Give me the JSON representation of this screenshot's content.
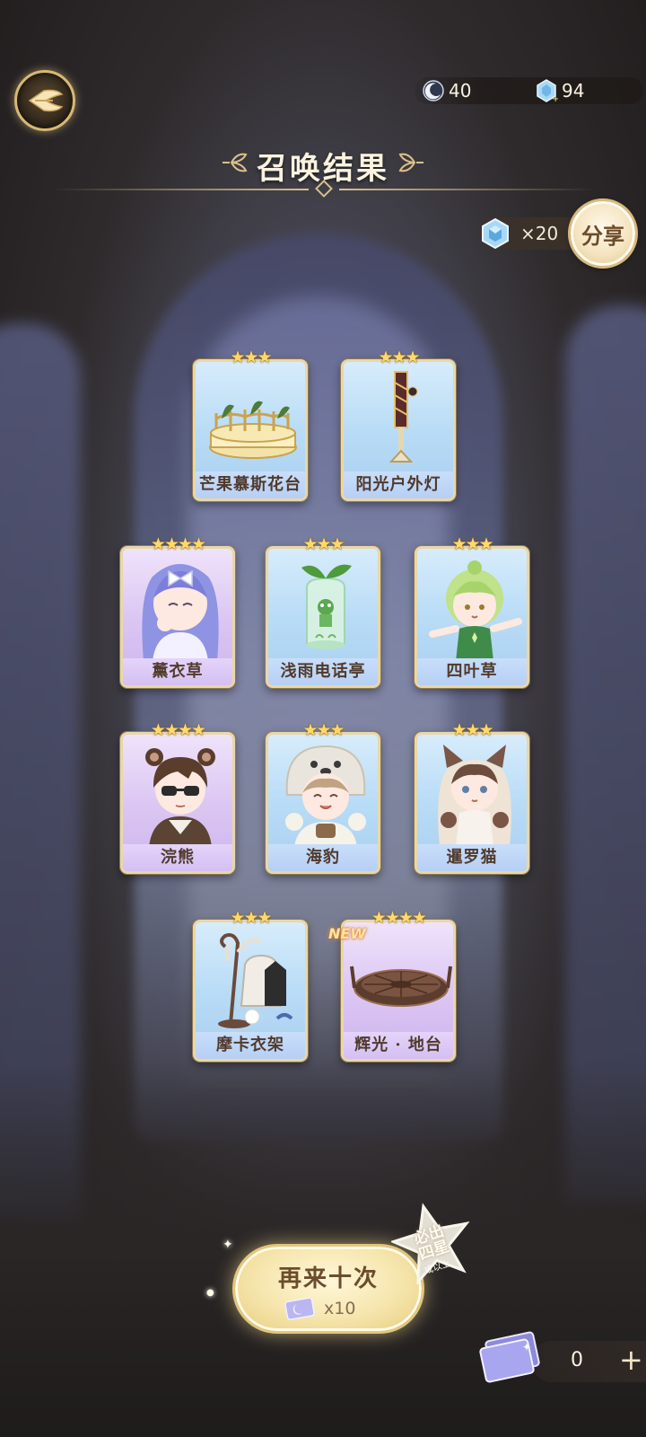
{
  "topbar": {
    "moon_count": "40",
    "gem_count": "94"
  },
  "page_title": "召唤结果",
  "share": {
    "reward_count": "×20",
    "label": "分享"
  },
  "cards": [
    {
      "name": "芒果慕斯花台",
      "stars": "★★★",
      "bg": "blue",
      "is_new": false
    },
    {
      "name": "阳光户外灯",
      "stars": "★★★",
      "bg": "blue",
      "is_new": false
    },
    {
      "name": "薰衣草",
      "stars": "★★★★",
      "bg": "purple",
      "is_new": false
    },
    {
      "name": "浅雨电话亭",
      "stars": "★★★",
      "bg": "blue",
      "is_new": false
    },
    {
      "name": "四叶草",
      "stars": "★★★",
      "bg": "blue",
      "is_new": false
    },
    {
      "name": "浣熊",
      "stars": "★★★★",
      "bg": "purple",
      "is_new": false
    },
    {
      "name": "海豹",
      "stars": "★★★",
      "bg": "blue",
      "is_new": false
    },
    {
      "name": "暹罗猫",
      "stars": "★★★",
      "bg": "blue",
      "is_new": false
    },
    {
      "name": "摩卡衣架",
      "stars": "★★★",
      "bg": "blue",
      "is_new": false
    },
    {
      "name": "辉光 · 地台",
      "stars": "★★★★",
      "bg": "purple",
      "is_new": true
    }
  ],
  "new_badge": "NEW",
  "pull_again": {
    "label": "再来十次",
    "cost": "x10"
  },
  "guarantee": {
    "line1": "必出",
    "line2": "四星",
    "sub": "或以上"
  },
  "tickets": {
    "count": "0",
    "plus": "+"
  },
  "colors": {
    "gold_accent": "#d9c08a",
    "star_gold": "#ffd86a",
    "card_blue": "#b9dcf6",
    "card_purple": "#dcc7f3"
  }
}
